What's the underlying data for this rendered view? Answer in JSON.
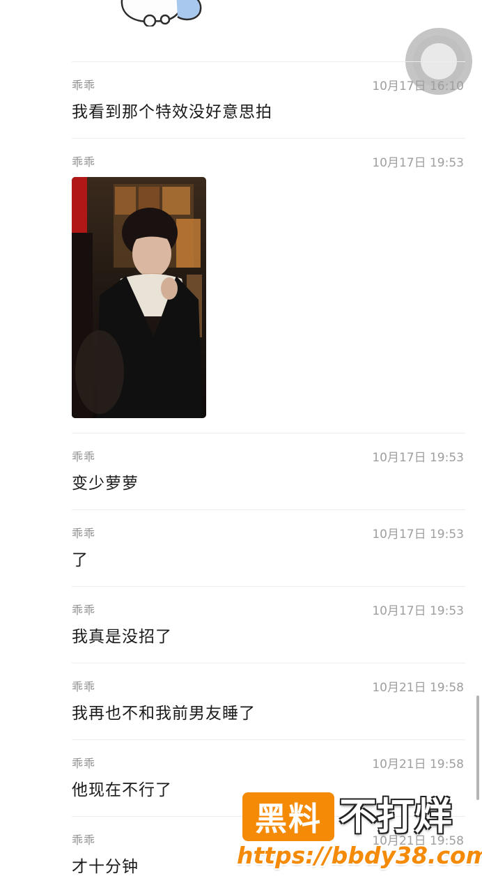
{
  "messages": [
    {
      "sender": "乖乖",
      "time": "10月17日 16:10",
      "text": "我看到那个特效没好意思拍"
    },
    {
      "sender": "乖乖",
      "time": "10月17日 19:53",
      "type": "image"
    },
    {
      "sender": "乖乖",
      "time": "10月17日 19:53",
      "text": "变少萝萝"
    },
    {
      "sender": "乖乖",
      "time": "10月17日 19:53",
      "text": "了"
    },
    {
      "sender": "乖乖",
      "time": "10月17日 19:53",
      "text": "我真是没招了"
    },
    {
      "sender": "乖乖",
      "time": "10月21日 19:58",
      "text": "我再也不和我前男友睡了"
    },
    {
      "sender": "乖乖",
      "time": "10月21日 19:58",
      "text": "他现在不行了"
    },
    {
      "sender": "乖乖",
      "time": "10月21日 19:58",
      "text": "才十分钟"
    }
  ],
  "watermark": {
    "logo": "黑料",
    "title": "不打烊",
    "url": "https://bbdy38.com"
  },
  "colors": {
    "accent": "#f58a07",
    "text": "#1a1a1a",
    "meta": "#9e9e9e",
    "divider": "#ededed"
  },
  "icons": [
    "sticker-icon",
    "assistive-touch-icon"
  ]
}
